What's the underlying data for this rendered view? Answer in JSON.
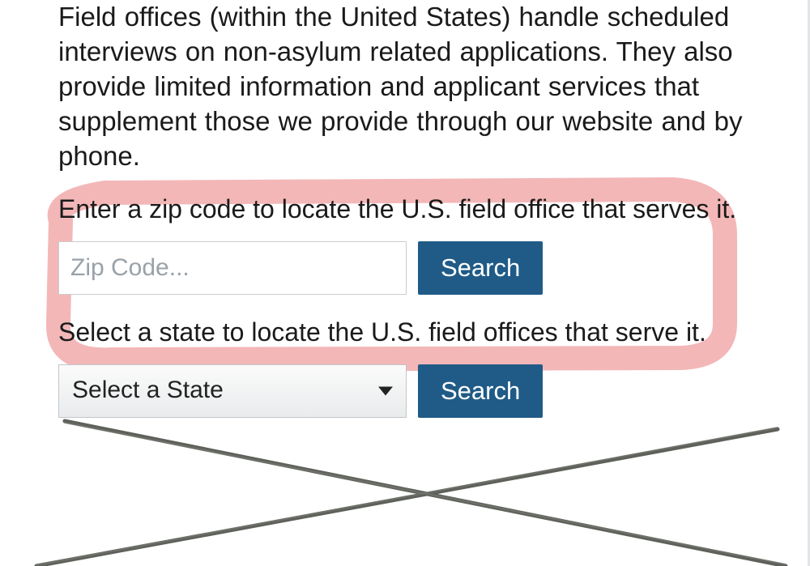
{
  "intro_text": "Field offices (within the United States) handle scheduled interviews on non-asylum related applications.  They also provide limited information and applicant services that supplement those we provide through our website and by phone.",
  "zip_section": {
    "prompt": "Enter a zip code to locate the U.S. field office that serves it.",
    "placeholder": "Zip Code...",
    "button": "Search"
  },
  "state_section": {
    "prompt": "Select a state to locate the U.S. field offices that serve it.",
    "selected": "Select a State",
    "button": "Search"
  },
  "annotations": {
    "circle_color": "#f2a9ab",
    "cross_color": "#5a5e57"
  }
}
